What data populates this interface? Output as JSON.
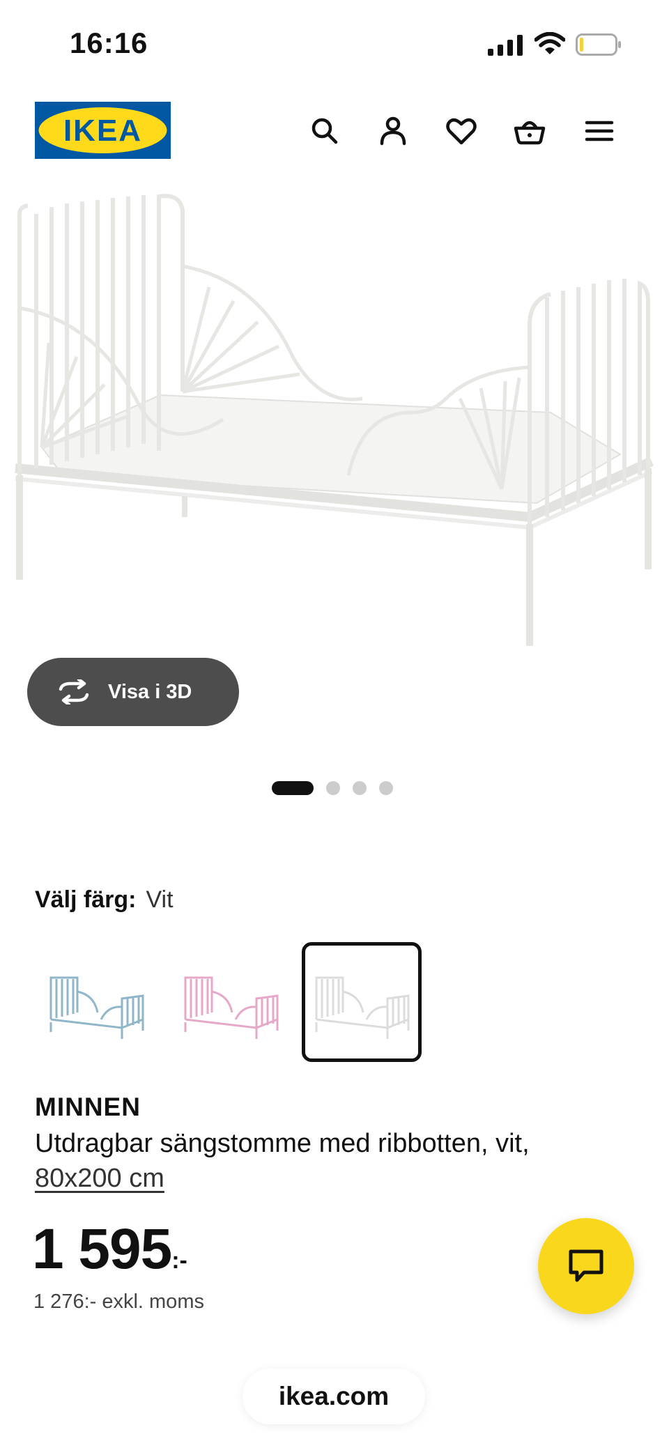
{
  "status_bar": {
    "time": "16:16"
  },
  "header": {
    "logo_text": "IKEA",
    "icons": [
      "search-icon",
      "account-icon",
      "heart-icon",
      "basket-icon",
      "menu-icon"
    ]
  },
  "view_3d": {
    "label": "Visa i 3D",
    "icon": "rotate-3d-icon"
  },
  "carousel": {
    "count": 4,
    "active": 1
  },
  "color_picker": {
    "label": "Välj färg:",
    "value": "Vit",
    "options": [
      {
        "color": "#8fb6c9"
      },
      {
        "color": "#e6a8c8"
      },
      {
        "color": "#e2e2e2",
        "selected": true
      }
    ]
  },
  "product": {
    "name": "MINNEN",
    "description": "Utdragbar sängstomme med ribbotten, vit,",
    "size": "80x200 cm",
    "price": "1 595",
    "price_suffix": ":-",
    "price_excl": "1 276:- exkl. moms"
  },
  "browser": {
    "url": "ikea.com"
  },
  "colors": {
    "brand_blue": "#0058a3",
    "brand_yellow": "#ffda1a",
    "chat_yellow": "#f9d71c",
    "button_dark": "#4d4d4d"
  }
}
